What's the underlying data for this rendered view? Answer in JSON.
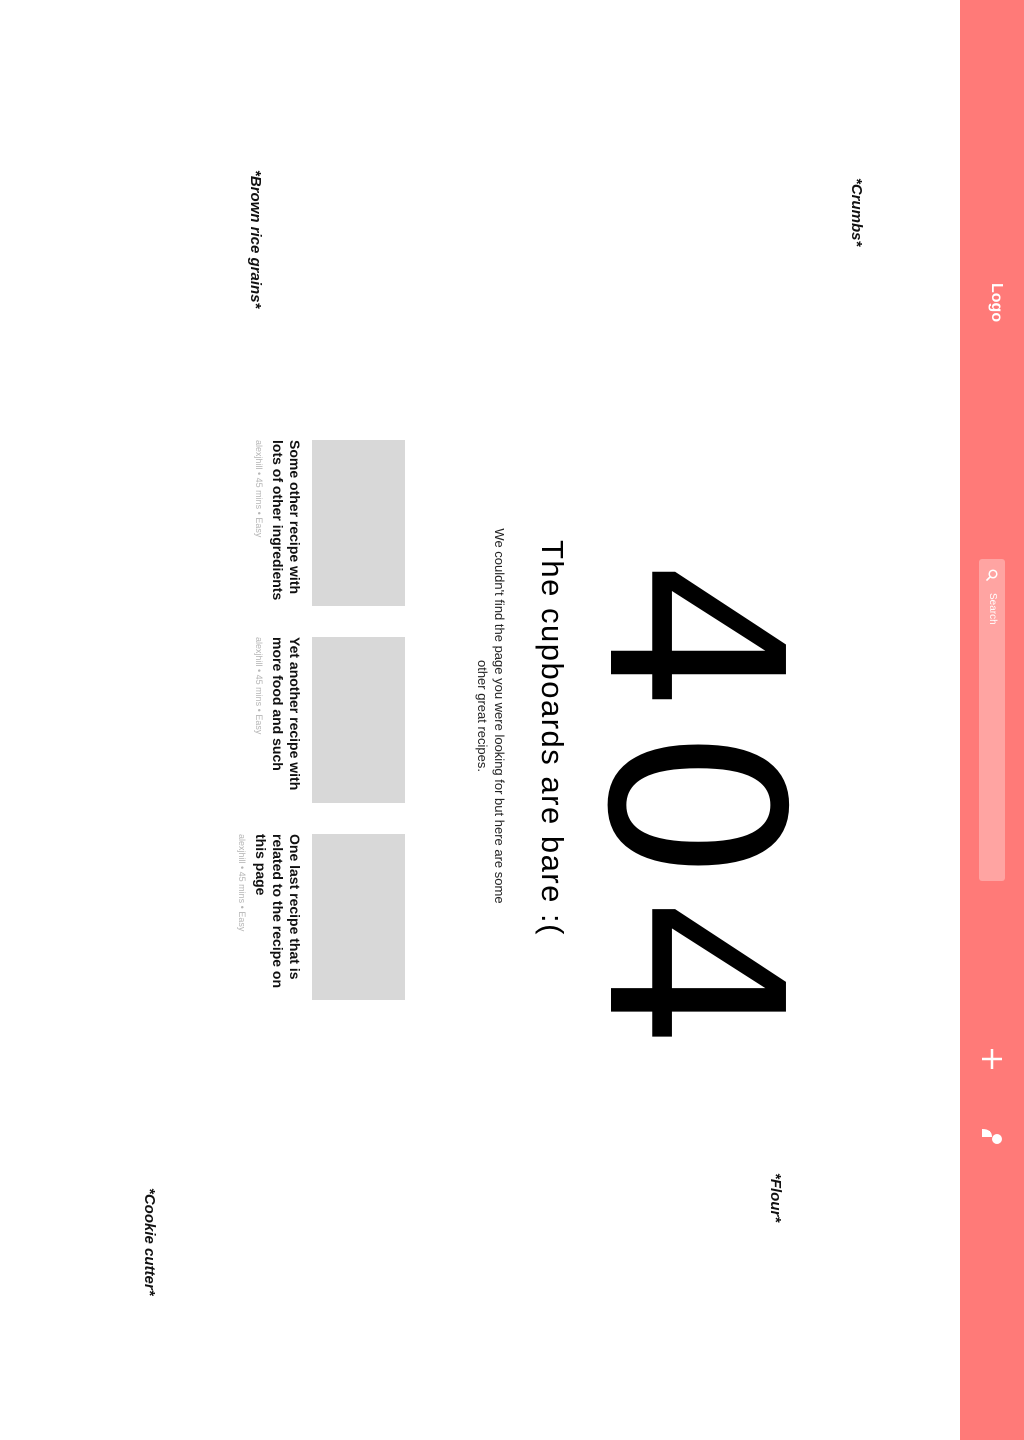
{
  "nav": {
    "logo": "Logo",
    "search_placeholder": "Search",
    "icons": [
      "search-icon",
      "plus-icon",
      "user-icon"
    ],
    "background_color": "#ff7a78"
  },
  "decorations": {
    "crumbs": "*Crumbs*",
    "brown_rice": "*Brown rice grains*",
    "flour": "*Flour*",
    "cookie_cutter": "*Cookie cutter*"
  },
  "error": {
    "code": "404",
    "headline": "The cupboards are bare :(",
    "message": "We couldn't find the page you were looking for but here are some other great recipes."
  },
  "recipes": [
    {
      "title": "Some other recipe with lots of other ingredients",
      "meta": "alexjhill  •  45 mins  •  Easy"
    },
    {
      "title": "Yet another recipe with more food and such",
      "meta": "alexjhill  •  45 mins  •  Easy"
    },
    {
      "title": "One last recipe that is related to the recipe on this page",
      "meta": "alexjhill  •  45 mins  •  Easy"
    }
  ]
}
